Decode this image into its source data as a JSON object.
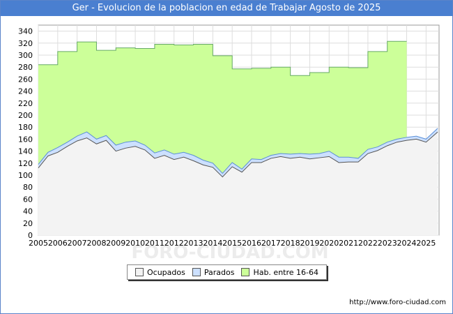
{
  "title": "Ger - Evolucion de la poblacion en edad de Trabajar Agosto de 2025",
  "watermark": "FORO-CIUDAD.COM",
  "footer_url": "http://www.foro-ciudad.com",
  "colors": {
    "title_bg": "#4a7fd0",
    "hab_fill": "#ccff99",
    "hab_line": "#66aa66",
    "parados_fill": "#cce0ff",
    "parados_line": "#5b8fd6",
    "ocupados_fill": "#f3f3f3",
    "ocupados_line": "#555555",
    "grid": "#dddddd"
  },
  "chart_data": {
    "type": "area",
    "title": "Ger - Evolucion de la poblacion en edad de Trabajar Agosto de 2025",
    "xlabel": "",
    "ylabel": "",
    "ylim": [
      0,
      350
    ],
    "xlim": [
      2005,
      2025.67
    ],
    "grid": true,
    "legend_position": "bottom",
    "y_ticks": [
      0,
      20,
      40,
      60,
      80,
      100,
      120,
      140,
      160,
      180,
      200,
      220,
      240,
      260,
      280,
      300,
      320,
      340
    ],
    "x_ticks": [
      "2005",
      "2006",
      "2007",
      "2008",
      "2009",
      "2010",
      "2011",
      "2012",
      "2013",
      "2014",
      "2015",
      "2016",
      "2017",
      "2018",
      "2019",
      "2020",
      "2021",
      "2022",
      "2023",
      "2024",
      "2025"
    ],
    "series": [
      {
        "name": "Hab. entre 16-64",
        "x": [
          2005,
          2006,
          2007,
          2008,
          2009,
          2010,
          2011,
          2012,
          2013,
          2014,
          2015,
          2016,
          2017,
          2018,
          2019,
          2020,
          2021,
          2022,
          2023,
          2024,
          2025
        ],
        "values": [
          284,
          306,
          322,
          308,
          312,
          311,
          318,
          317,
          318,
          299,
          277,
          278,
          280,
          266,
          271,
          280,
          279,
          306,
          323,
          null,
          null
        ]
      },
      {
        "name": "Parados",
        "x": [
          2005,
          2005.5,
          2006,
          2006.5,
          2007,
          2007.5,
          2008,
          2008.5,
          2009,
          2009.5,
          2010,
          2010.5,
          2011,
          2011.5,
          2012,
          2012.5,
          2013,
          2013.5,
          2014,
          2014.5,
          2015,
          2015.5,
          2016,
          2016.5,
          2017,
          2017.5,
          2018,
          2018.5,
          2019,
          2019.5,
          2020,
          2020.5,
          2021,
          2021.5,
          2022,
          2022.5,
          2023,
          2023.5,
          2024,
          2024.5,
          2025,
          2025.6
        ],
        "values": [
          118,
          138,
          146,
          155,
          165,
          172,
          160,
          166,
          150,
          155,
          157,
          150,
          137,
          142,
          135,
          138,
          133,
          125,
          120,
          103,
          121,
          110,
          127,
          126,
          133,
          136,
          135,
          136,
          135,
          136,
          140,
          130,
          130,
          128,
          143,
          147,
          155,
          160,
          163,
          165,
          160,
          178
        ]
      },
      {
        "name": "Ocupados",
        "x": [
          2005,
          2005.5,
          2006,
          2006.5,
          2007,
          2007.5,
          2008,
          2008.5,
          2009,
          2009.5,
          2010,
          2010.5,
          2011,
          2011.5,
          2012,
          2012.5,
          2013,
          2013.5,
          2014,
          2014.5,
          2015,
          2015.5,
          2016,
          2016.5,
          2017,
          2017.5,
          2018,
          2018.5,
          2019,
          2019.5,
          2020,
          2020.5,
          2021,
          2021.5,
          2022,
          2022.5,
          2023,
          2023.5,
          2024,
          2024.5,
          2025,
          2025.6
        ],
        "values": [
          112,
          132,
          138,
          148,
          157,
          162,
          152,
          158,
          140,
          145,
          148,
          142,
          128,
          133,
          126,
          130,
          124,
          117,
          113,
          97,
          114,
          105,
          121,
          121,
          128,
          131,
          128,
          130,
          127,
          129,
          131,
          121,
          122,
          122,
          136,
          141,
          149,
          155,
          158,
          160,
          155,
          172
        ]
      }
    ]
  },
  "legend": [
    {
      "label": "Ocupados",
      "swatch_color": "#f3f3f3"
    },
    {
      "label": "Parados",
      "swatch_color": "#cce0ff"
    },
    {
      "label": "Hab. entre 16-64",
      "swatch_color": "#ccff99"
    }
  ]
}
